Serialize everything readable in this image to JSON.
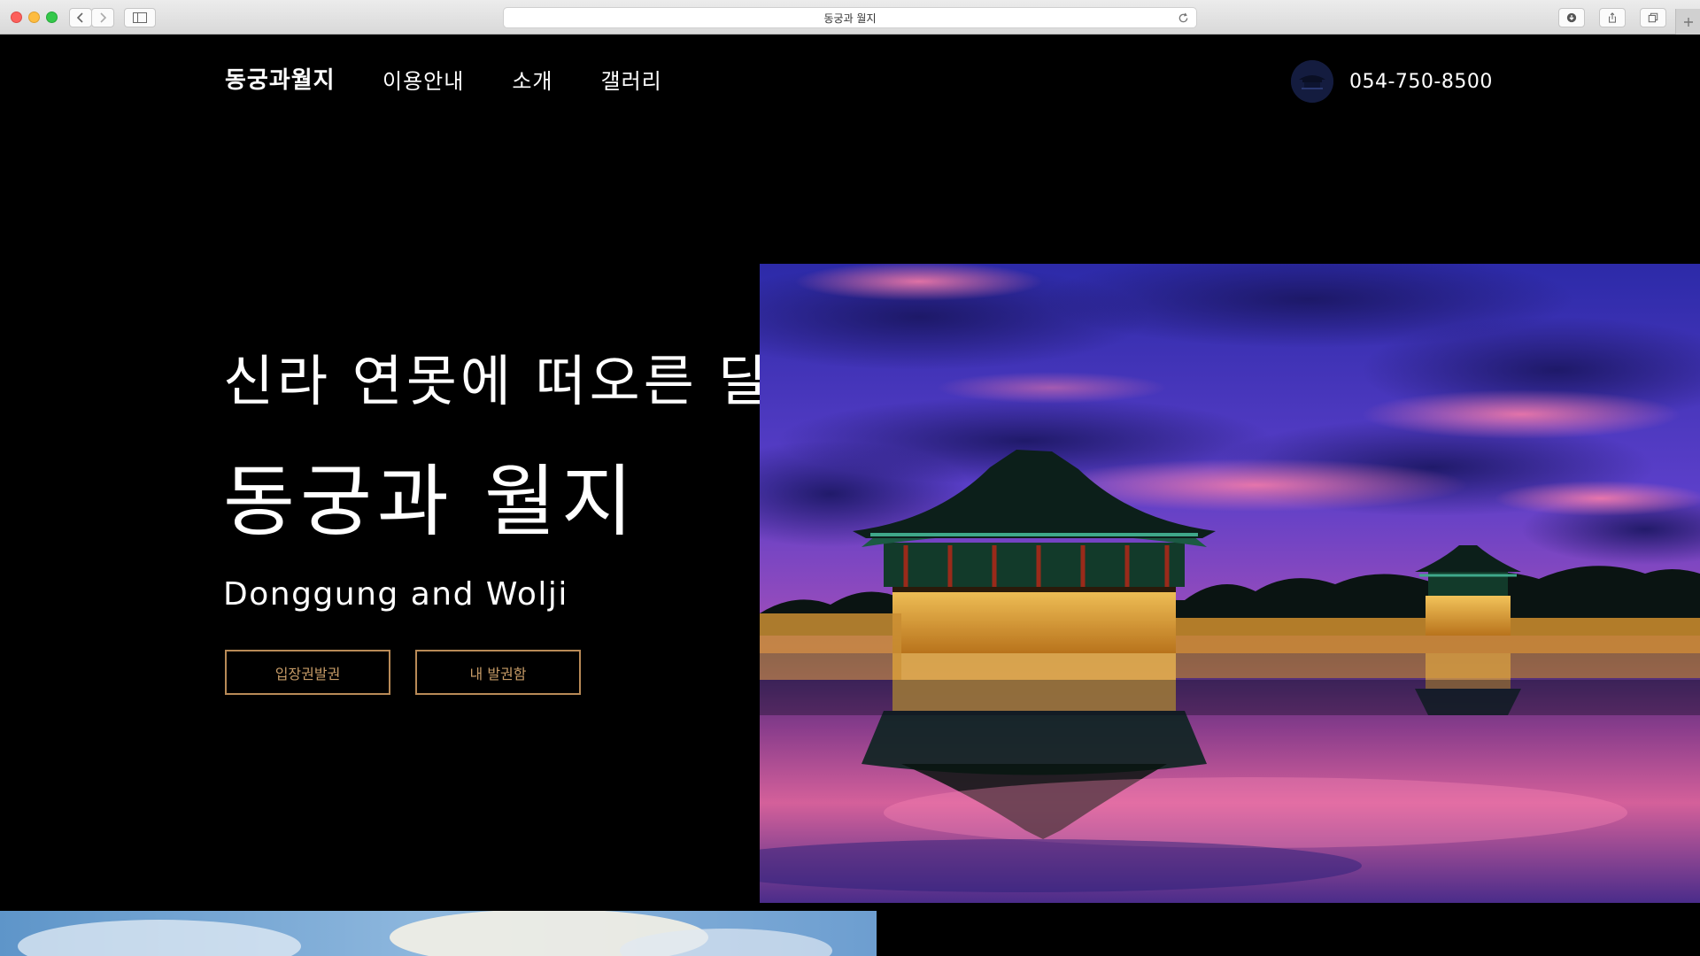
{
  "browser": {
    "tab_title": "동궁과 월지"
  },
  "header": {
    "logo": "동궁과월지",
    "menu": [
      {
        "label": "이용안내"
      },
      {
        "label": "소개"
      },
      {
        "label": "갤러리"
      }
    ],
    "phone": "054-750-8500"
  },
  "hero": {
    "subtitle": "신라 연못에 떠오른 달",
    "title": "동궁과 월지",
    "english": "Donggung and Wolji",
    "buttons": {
      "ticket": "입장권발권",
      "my_tickets": "내 발권함"
    }
  },
  "colors": {
    "background": "#000000",
    "button_border": "#b88a57",
    "button_text": "#c59a66",
    "text": "#ffffff"
  }
}
